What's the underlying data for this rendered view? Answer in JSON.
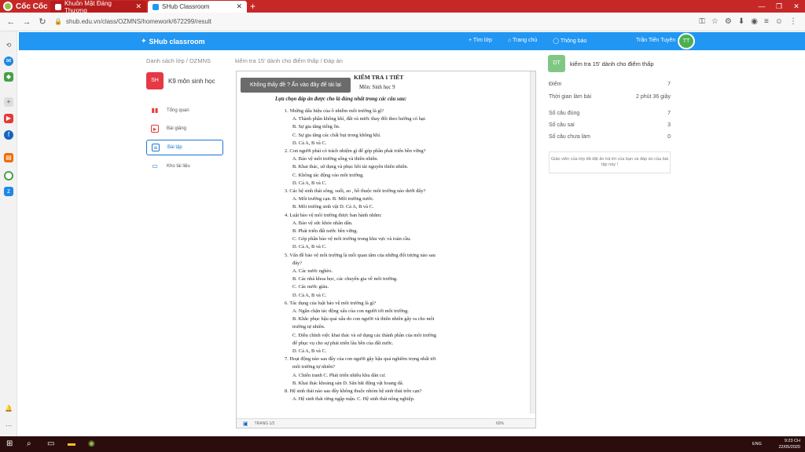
{
  "browser": {
    "brand": "Cốc Cốc",
    "tabs": [
      {
        "label": "Khuôn Mặt Đáng Thương"
      },
      {
        "label": "SHub Classroom"
      }
    ],
    "new_tab": "+",
    "url": "shub.edu.vn/class/OZMNS/homework/672299/result"
  },
  "app": {
    "name": "SHub classroom",
    "nav": [
      "+ Tìm lớp",
      "Trang chủ",
      "Thông báo"
    ],
    "user_name": "Trần Tiến Tuyên",
    "user_initials": "TT"
  },
  "breadcrumb": {
    "left": "Danh sách lớp  /  OZMNS",
    "right": "kiểm tra 15' dành cho điểm thấp  /  Đáp án"
  },
  "class": {
    "badge": "SH",
    "name": "K9 môn sinh học"
  },
  "menu": [
    {
      "label": "Tổng quan",
      "icon": "bar-chart-icon"
    },
    {
      "label": "Bài giảng",
      "icon": "video-icon"
    },
    {
      "label": "Bài tập",
      "icon": "assignment-icon"
    },
    {
      "label": "Kho tài liệu",
      "icon": "folder-icon"
    }
  ],
  "hint": "Không thấy đề ? Ấn vào đây để tải lại",
  "document": {
    "title": "KIỂM TRA 1 TIẾT",
    "subject": "Môn: Sinh học 9",
    "instruction": "Lựa chọn đáp án được cho là đúng nhất trong các câu sau:",
    "lines": [
      "1.  Những dấu hiệu của ô nhiễm môi trường là gì?",
      "A.  Thành phần không khí, đất và nước thay đổi theo hướng có hại.",
      "B.  Sự gia tăng tiếng ồn.",
      "C.  Sự gia tăng các chất bụi trong không khí.",
      "D.  Cả A, B và C.",
      "2.  Con người phải có trách nhiệm gì để góp phần phát triển bền vững?",
      "A.  Bảo vệ môi trường sống và thiên nhiên.",
      "B.  Khai thác, sử dụng và phục hồi tài nguyên thiên nhiên.",
      "C.  Không tác động vào môi trường.",
      "D.  Cả A, B và C.",
      "3.  Các hệ sinh thái sông, suối, ao , hồ thuộc môi trường nào dưới đây?",
      "A.  Môi trường cạn.                     B. Môi trường nước.",
      "B.  Môi trường sinh vật               D. Cả A, B và C.",
      "4.  Luật bảo vệ môi trường được ban hành nhằm:",
      "A.  Bảo vệ sức khỏe nhân dân.",
      "B.  Phát triển đất nước bền vững.",
      "C.  Góp phần bảo vệ môi trường trong khu vực và toàn cầu.",
      "D.  Cả A, B và C.",
      "5.  Vấn đề bảo vệ môi trường là mối quan tâm của những đối tượng nào sau",
      "đây?",
      "A.  Các nước nghèo.",
      "B.  Các nhà khoa học, các chuyên gia về môi trường.",
      "C.  Các nước giàu.",
      "D.  Cả A, B và C.",
      "6.  Tác dụng của luật bảo vệ môi trường là gì?",
      "A.  Ngăn chặn tác động xấu của con người tới môi trường.",
      "B.  Khắc phục hậu quả xấu do con người và thiên nhiên gây ra cho môi",
      "trường tự nhiên.",
      "C.  Điều chỉnh việc khai thác và sử dụng các thành phần của môi trường",
      "để phục vụ cho sự phát triển lâu bền của đất nước.",
      "D.  Cả A, B và C.",
      "7.  Hoạt động nào sau đây của con người gây hậu quả nghiêm trọng nhất tới",
      "môi trường tự nhiên?",
      "A.  Chiến tranh                      C. Phát triển nhiều khu dân cư.",
      "B.  Khai thác khoáng sản              D. Săn bắt động vật hoang dã.",
      "8.  Hệ sinh thái nào sau đây không thuộc nhóm hệ sinh thái trên cạn?",
      "A.  Hệ sinh thái rừng ngập mặn.         C. Hệ sinh thái nông nghiệp."
    ],
    "status_left": "TRANG 1/2",
    "status_right": "60%"
  },
  "result": {
    "badge": "DT",
    "title": "kiểm tra 15' dành cho điểm thấp",
    "stats": [
      {
        "label": "Điểm",
        "value": "7"
      },
      {
        "label": "Thời gian làm bài",
        "value": "2 phút 36 giây"
      },
      {
        "label": "Số câu đúng",
        "value": "7"
      },
      {
        "label": "Số câu sai",
        "value": "3"
      },
      {
        "label": "Số câu chưa làm",
        "value": "0"
      }
    ],
    "notice": "Giáo viên của lớp đã đặt ẩn trả lời của bạn và đáp án của bài tập này !"
  },
  "taskbar": {
    "lang": "ENG",
    "time": "9:23 CH",
    "date": "22/05/2020"
  },
  "colors": {
    "tabbar": "#c62828",
    "appbar": "#2196f3",
    "accent": "#1976d2"
  }
}
